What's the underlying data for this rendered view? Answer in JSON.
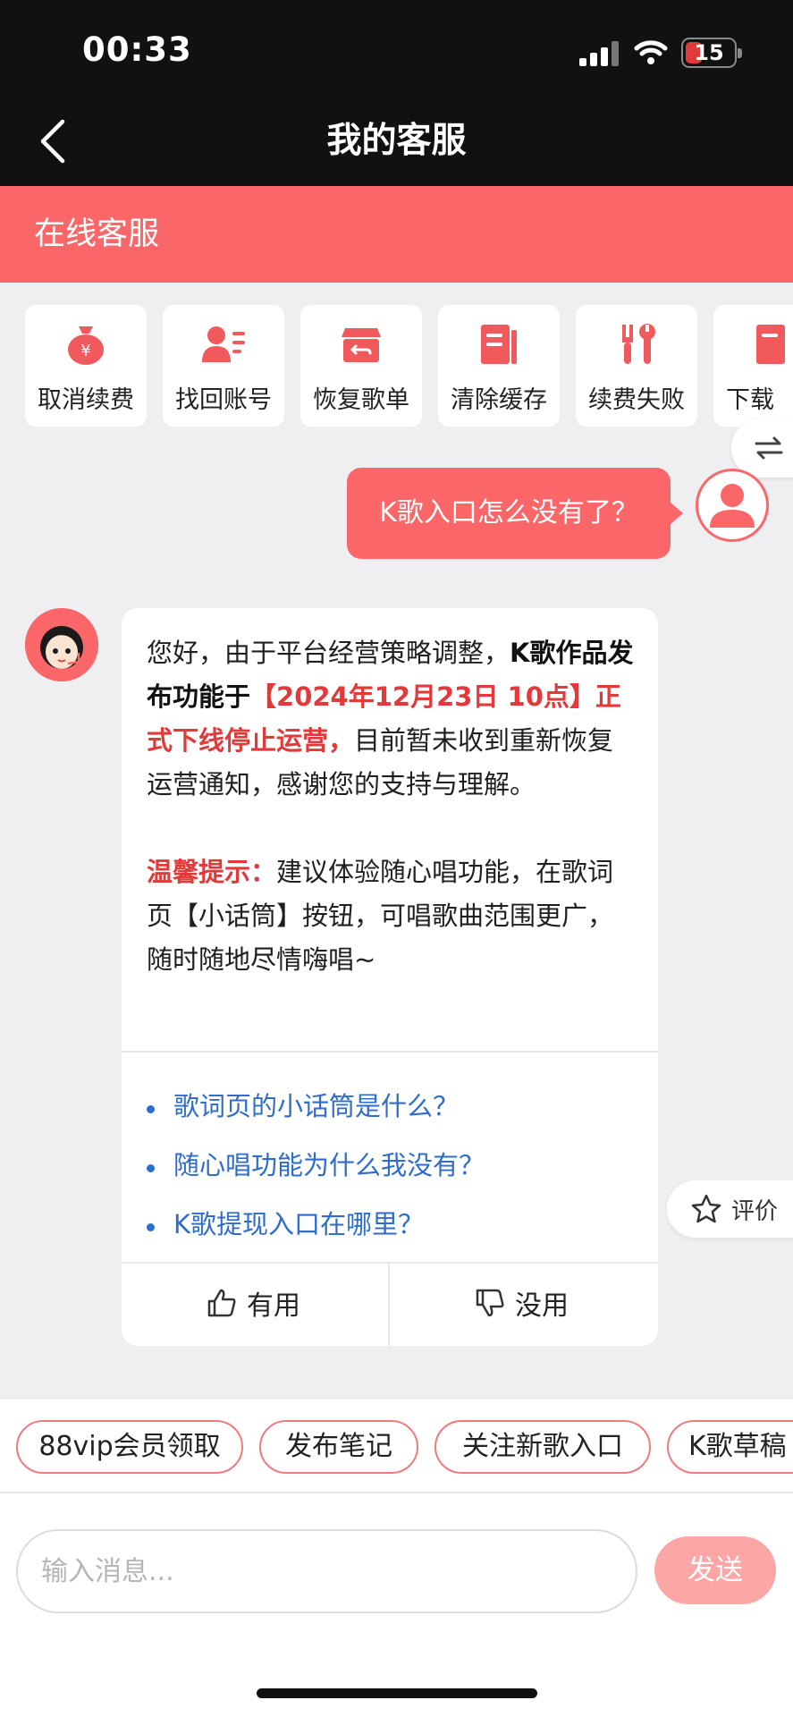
{
  "status": {
    "time": "00:33",
    "battery": "15"
  },
  "header": {
    "title": "我的客服"
  },
  "banner": {
    "label": "在线客服"
  },
  "quick_tiles": [
    {
      "label": "取消续费",
      "icon": "money-bag-icon"
    },
    {
      "label": "找回账号",
      "icon": "account-card-icon"
    },
    {
      "label": "恢复歌单",
      "icon": "restore-box-icon"
    },
    {
      "label": "清除缓存",
      "icon": "document-icon"
    },
    {
      "label": "续费失败",
      "icon": "tools-icon"
    },
    {
      "label": "下载",
      "icon": "document-icon"
    }
  ],
  "user_message": "K歌入口怎么没有了？",
  "agent_message": {
    "p1_a": "您好，由于平台经营策略调整，",
    "p1_b": "K歌作品发布功能于",
    "p1_c": "【2024年12月23日 10点】正式下线停止运营，",
    "p1_d": "目前暂未收到重新恢复运营通知，感谢您的支持与理解。",
    "p2_a": "温馨提示：",
    "p2_b": "建议体验随心唱功能，在歌词页【小话筒】按钮，可唱歌曲范围更广，随时随地尽情嗨唱~",
    "questions": [
      "歌词页的小话筒是什么？",
      "随心唱功能为什么我没有？",
      "K歌提现入口在哪里？"
    ],
    "useful": "有用",
    "useless": "没用"
  },
  "rate": {
    "label": "评价"
  },
  "chips": [
    "88vip会员领取",
    "发布笔记",
    "关注新歌入口",
    "K歌草稿"
  ],
  "input": {
    "placeholder": "输入消息..."
  },
  "send": "发送",
  "colors": {
    "accent": "#fb6668",
    "link": "#2e6ccd",
    "highlight": "#e23a3a"
  }
}
